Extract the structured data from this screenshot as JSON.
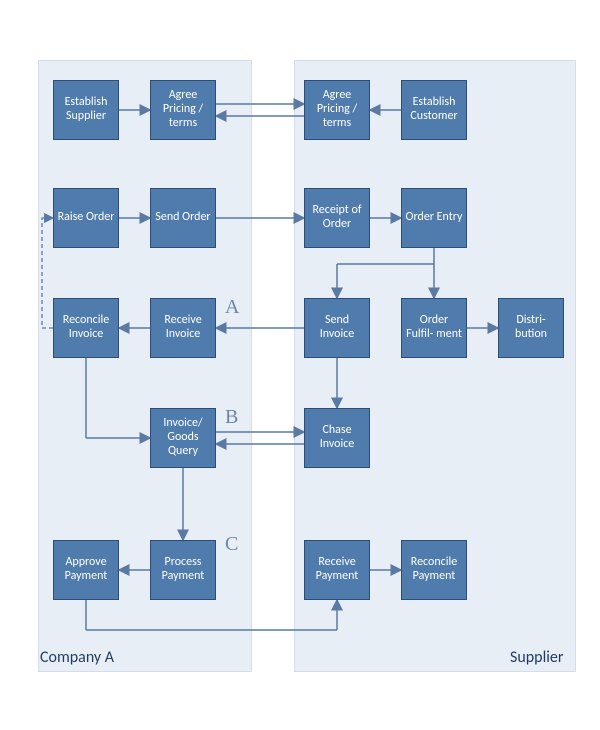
{
  "lanes": {
    "left": {
      "label": "Company A"
    },
    "right": {
      "label": "Supplier"
    }
  },
  "nodes": {
    "establish_supplier": "Establish Supplier",
    "agree_terms_left": "Agree Pricing / terms",
    "agree_terms_right": "Agree Pricing / terms",
    "establish_customer": "Establish Customer",
    "raise_order": "Raise Order",
    "send_order": "Send Order",
    "receipt_of_order": "Receipt of Order",
    "order_entry": "Order Entry",
    "reconcile_invoice": "Reconcile Invoice",
    "receive_invoice": "Receive Invoice",
    "send_invoice": "Send Invoice",
    "order_fulfilment": "Order Fulfil-\nment",
    "distribution": "Distri-\nbution",
    "invoice_goods_query": "Invoice/ Goods Query",
    "chase_invoice": "Chase Invoice",
    "approve_payment": "Approve Payment",
    "process_payment": "Process Payment",
    "receive_payment": "Receive Payment",
    "reconcile_payment": "Reconcile Payment"
  },
  "badges": {
    "a": "A",
    "b": "B",
    "c": "C"
  },
  "colors": {
    "box_fill": "#4f7bad",
    "box_border": "#2c4d78",
    "lane_fill": "#e8eef5",
    "arrow": "#5a7aa3",
    "arrow_dash": "#5a7aa3"
  }
}
